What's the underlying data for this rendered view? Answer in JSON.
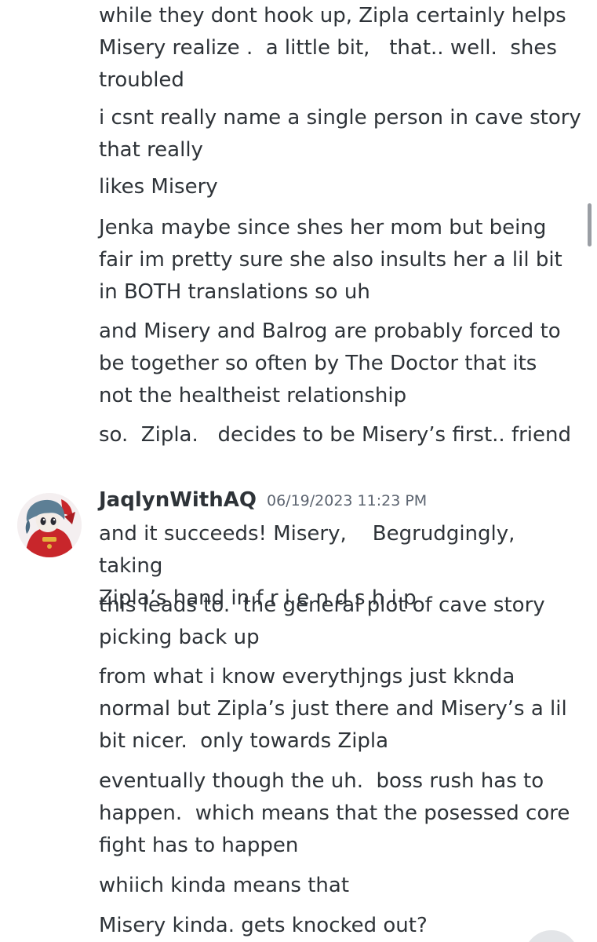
{
  "messages_before": [
    "while they dont hook up, Zipla certainly helps\nMisery realize .  a little bit,   that.. well.  shes\ntroubled",
    "i csnt really name a single person in cave story\nthat really",
    "likes Misery",
    "Jenka maybe since shes her mom but being\nfair im pretty sure she also insults her a lil bit\nin BOTH translations so uh",
    "and Misery and Balrog are probably forced to\nbe together so often by The Doctor that its\nnot the healtheist relationship",
    "so.  Zipla.   decides to be Misery’s first.. friend"
  ],
  "author": {
    "name": "JaqlynWithAQ",
    "timestamp": "06/19/2023 11:23 PM",
    "avatar_icon": "character-avatar-icon"
  },
  "messages_after": [
    "and it succeeds! Misery,    Begrudgingly, taking\nZipla’s hand in f r i e n d s h i p",
    "this leads to.  the general plot of cave story\npicking back up",
    "from what i know everythjngs just kknda\nnormal but Zipla’s just there and Misery’s a lil\nbit nicer.  only towards Zipla",
    "eventually though the uh.  boss rush has to\nhappen.  which means that the posessed core\nfight has to happen",
    "whiich kinda means that",
    "Misery kinda. gets knocked out?"
  ],
  "colors": {
    "background": "#ffffff",
    "text": "#2e3338",
    "timestamp": "#5c6470"
  }
}
